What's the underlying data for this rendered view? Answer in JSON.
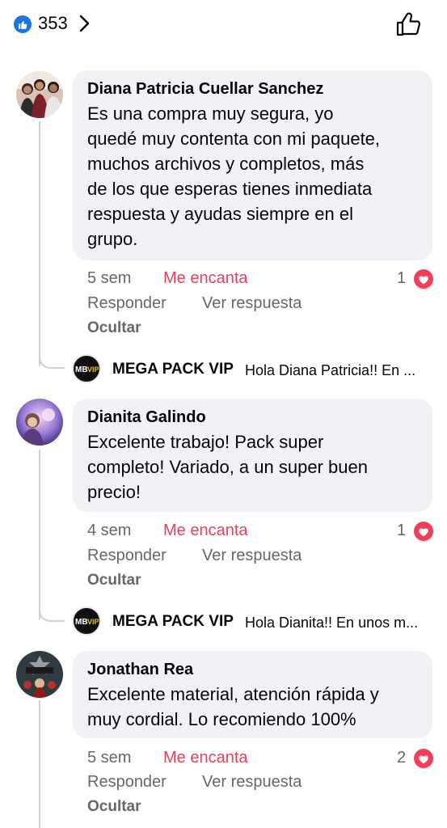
{
  "header": {
    "reaction_count": "353",
    "reaction_icon": "like-icon",
    "colors": {
      "like_blue": "#1b74e4",
      "love_red": "#f33e58",
      "accent_text": "#e4405f"
    }
  },
  "comments": [
    {
      "author": "Diana Patricia Cuellar Sanchez",
      "text_lines": [
        "Es una compra muy segura, yo",
        "quedé muy contenta con mi paquete,",
        "muchos archivos y completos, más",
        "de los que esperas tienes inmediata",
        "respuesta y ayudas siempre en el",
        "grupo."
      ],
      "time": "5 sem",
      "reaction_label": "Me encanta",
      "reaction_count": "1",
      "reply_label": "Responder",
      "see_reply_label": "Ver respuesta",
      "hide_label": "Ocultar",
      "reply": {
        "author": "MEGA PACK VIP",
        "preview": "Hola Diana Patricia!! En ..."
      }
    },
    {
      "author": "Dianita Galindo",
      "text_lines": [
        "Excelente trabajo! Pack super",
        "completo! Variado, a un super buen",
        "precio!"
      ],
      "time": "4 sem",
      "reaction_label": "Me encanta",
      "reaction_count": "1",
      "reply_label": "Responder",
      "see_reply_label": "Ver respuesta",
      "hide_label": "Ocultar",
      "reply": {
        "author": "MEGA PACK VIP",
        "preview": "Hola Dianita!! En unos m..."
      }
    },
    {
      "author": "Jonathan Rea",
      "text_lines": [
        "Excelente material, atención rápida y",
        "muy cordial. Lo recomiendo 100%"
      ],
      "time": "5 sem",
      "reaction_label": "Me encanta",
      "reaction_count": "2",
      "reply_label": "Responder",
      "see_reply_label": "Ver respuesta",
      "hide_label": "Ocultar"
    }
  ]
}
